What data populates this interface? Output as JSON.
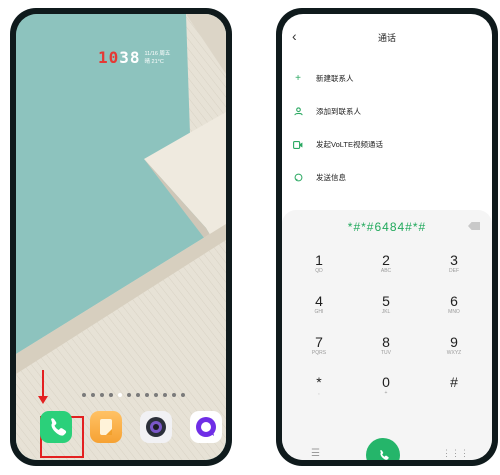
{
  "lock": {
    "time_red": "10",
    "time_rest": "38",
    "date": "11/16 周五",
    "weather": "晴 21°C"
  },
  "dock": {
    "apps": [
      "phone",
      "notes",
      "camera",
      "messages"
    ]
  },
  "dialer": {
    "title": "通话",
    "menu": [
      {
        "icon": "+",
        "label": "新建联系人"
      },
      {
        "icon": "user",
        "label": "添加到联系人"
      },
      {
        "icon": "video",
        "label": "发起VoLTE视频通话"
      },
      {
        "icon": "chat",
        "label": "发送信息"
      }
    ],
    "number": "*#*#6484#*#",
    "keys": [
      {
        "d": "1",
        "l": "QD"
      },
      {
        "d": "2",
        "l": "ABC"
      },
      {
        "d": "3",
        "l": "DEF"
      },
      {
        "d": "4",
        "l": "GHI"
      },
      {
        "d": "5",
        "l": "JKL"
      },
      {
        "d": "6",
        "l": "MNO"
      },
      {
        "d": "7",
        "l": "PQRS"
      },
      {
        "d": "8",
        "l": "TUV"
      },
      {
        "d": "9",
        "l": "WXYZ"
      },
      {
        "d": "*",
        "l": ","
      },
      {
        "d": "0",
        "l": "+"
      },
      {
        "d": "#",
        "l": ""
      }
    ]
  }
}
